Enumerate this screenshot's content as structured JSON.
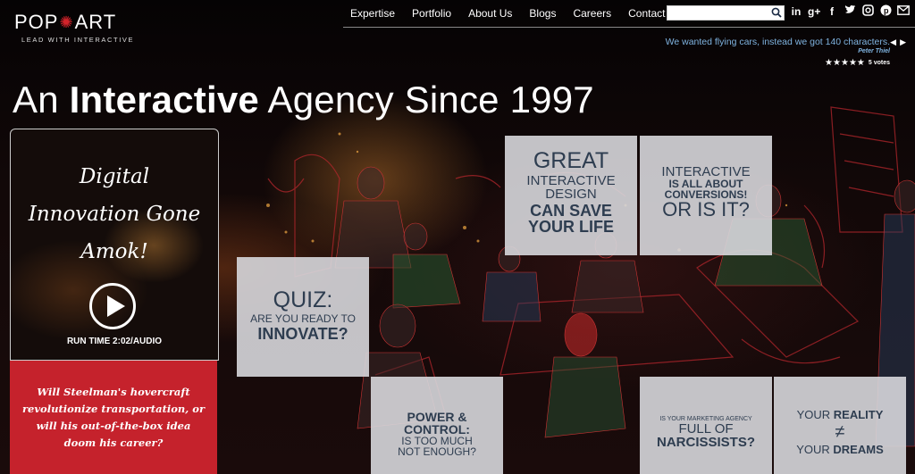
{
  "logo": {
    "text_a": "POP",
    "text_b": "ART",
    "tagline": "LEAD WITH INTERACTIVE"
  },
  "nav": {
    "items": [
      "Expertise",
      "Portfolio",
      "About Us",
      "Blogs",
      "Careers",
      "Contact Us"
    ]
  },
  "search": {
    "placeholder": ""
  },
  "social": [
    "linkedin-icon",
    "google-plus-icon",
    "facebook-icon",
    "twitter-icon",
    "instagram-icon",
    "pinterest-icon",
    "email-icon"
  ],
  "quote": {
    "text": "We wanted flying cars, instead we got 140 characters.",
    "author": "Peter Thiel",
    "stars": 5,
    "votes": "5 votes"
  },
  "headline": {
    "part1": "An ",
    "bold": "Interactive",
    "part2": " Agency Since 1997"
  },
  "video": {
    "title_lines": [
      "Digital",
      "Innovation Gone",
      "Amok!"
    ],
    "runtime": "RUN TIME 2:02/AUDIO"
  },
  "promo": {
    "text": "Will Steelman's hovercraft revolutionize transportation, or will his out-of-the-box idea doom his career?"
  },
  "tiles": {
    "great": {
      "l1": "GREAT",
      "l2": "INTERACTIVE",
      "l3": "DESIGN",
      "l4": "CAN SAVE",
      "l5": "YOUR LIFE"
    },
    "conv": {
      "l1": "INTERACTIVE",
      "l2": "IS ALL ABOUT",
      "l3": "CONVERSIONS!",
      "l4": "OR IS IT?"
    },
    "quiz": {
      "l1": "QUIZ:",
      "l2": "ARE YOU READY TO",
      "l3": "INNOVATE?"
    },
    "power": {
      "l1": "POWER &",
      "l2": "CONTROL:",
      "l3": "IS TOO MUCH",
      "l4": "NOT ENOUGH?"
    },
    "narc": {
      "l1": "IS YOUR MARKETING AGENCY",
      "l2": "FULL OF",
      "l3": "NARCISSISTS?"
    },
    "reality": {
      "l1a": "YOUR ",
      "l1b": "REALITY",
      "l2": "≠",
      "l3a": "YOUR ",
      "l3b": "DREAMS"
    }
  },
  "colors": {
    "accent_red": "#c5222c",
    "tile_text": "#2e3d50",
    "quote_blue": "#7fb3e0"
  }
}
